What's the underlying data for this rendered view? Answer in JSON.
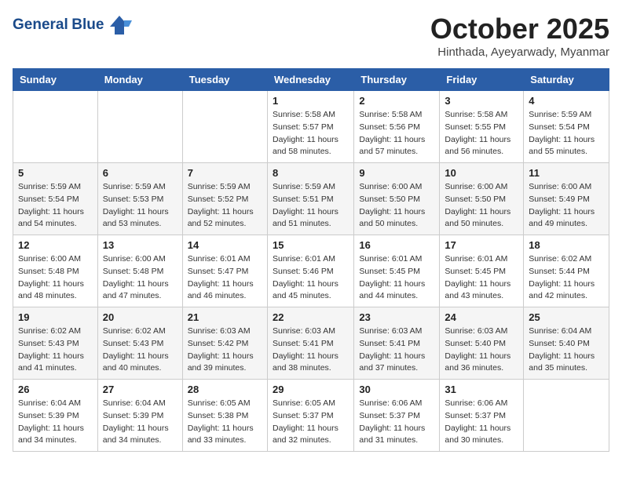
{
  "header": {
    "logo_line1": "General",
    "logo_line2": "Blue",
    "month_title": "October 2025",
    "subtitle": "Hinthada, Ayeyarwady, Myanmar"
  },
  "weekdays": [
    "Sunday",
    "Monday",
    "Tuesday",
    "Wednesday",
    "Thursday",
    "Friday",
    "Saturday"
  ],
  "weeks": [
    [
      {
        "day": "",
        "sunrise": "",
        "sunset": "",
        "daylight": ""
      },
      {
        "day": "",
        "sunrise": "",
        "sunset": "",
        "daylight": ""
      },
      {
        "day": "",
        "sunrise": "",
        "sunset": "",
        "daylight": ""
      },
      {
        "day": "1",
        "sunrise": "5:58 AM",
        "sunset": "5:57 PM",
        "daylight": "11 hours and 58 minutes."
      },
      {
        "day": "2",
        "sunrise": "5:58 AM",
        "sunset": "5:56 PM",
        "daylight": "11 hours and 57 minutes."
      },
      {
        "day": "3",
        "sunrise": "5:58 AM",
        "sunset": "5:55 PM",
        "daylight": "11 hours and 56 minutes."
      },
      {
        "day": "4",
        "sunrise": "5:59 AM",
        "sunset": "5:54 PM",
        "daylight": "11 hours and 55 minutes."
      }
    ],
    [
      {
        "day": "5",
        "sunrise": "5:59 AM",
        "sunset": "5:54 PM",
        "daylight": "11 hours and 54 minutes."
      },
      {
        "day": "6",
        "sunrise": "5:59 AM",
        "sunset": "5:53 PM",
        "daylight": "11 hours and 53 minutes."
      },
      {
        "day": "7",
        "sunrise": "5:59 AM",
        "sunset": "5:52 PM",
        "daylight": "11 hours and 52 minutes."
      },
      {
        "day": "8",
        "sunrise": "5:59 AM",
        "sunset": "5:51 PM",
        "daylight": "11 hours and 51 minutes."
      },
      {
        "day": "9",
        "sunrise": "6:00 AM",
        "sunset": "5:50 PM",
        "daylight": "11 hours and 50 minutes."
      },
      {
        "day": "10",
        "sunrise": "6:00 AM",
        "sunset": "5:50 PM",
        "daylight": "11 hours and 50 minutes."
      },
      {
        "day": "11",
        "sunrise": "6:00 AM",
        "sunset": "5:49 PM",
        "daylight": "11 hours and 49 minutes."
      }
    ],
    [
      {
        "day": "12",
        "sunrise": "6:00 AM",
        "sunset": "5:48 PM",
        "daylight": "11 hours and 48 minutes."
      },
      {
        "day": "13",
        "sunrise": "6:00 AM",
        "sunset": "5:48 PM",
        "daylight": "11 hours and 47 minutes."
      },
      {
        "day": "14",
        "sunrise": "6:01 AM",
        "sunset": "5:47 PM",
        "daylight": "11 hours and 46 minutes."
      },
      {
        "day": "15",
        "sunrise": "6:01 AM",
        "sunset": "5:46 PM",
        "daylight": "11 hours and 45 minutes."
      },
      {
        "day": "16",
        "sunrise": "6:01 AM",
        "sunset": "5:45 PM",
        "daylight": "11 hours and 44 minutes."
      },
      {
        "day": "17",
        "sunrise": "6:01 AM",
        "sunset": "5:45 PM",
        "daylight": "11 hours and 43 minutes."
      },
      {
        "day": "18",
        "sunrise": "6:02 AM",
        "sunset": "5:44 PM",
        "daylight": "11 hours and 42 minutes."
      }
    ],
    [
      {
        "day": "19",
        "sunrise": "6:02 AM",
        "sunset": "5:43 PM",
        "daylight": "11 hours and 41 minutes."
      },
      {
        "day": "20",
        "sunrise": "6:02 AM",
        "sunset": "5:43 PM",
        "daylight": "11 hours and 40 minutes."
      },
      {
        "day": "21",
        "sunrise": "6:03 AM",
        "sunset": "5:42 PM",
        "daylight": "11 hours and 39 minutes."
      },
      {
        "day": "22",
        "sunrise": "6:03 AM",
        "sunset": "5:41 PM",
        "daylight": "11 hours and 38 minutes."
      },
      {
        "day": "23",
        "sunrise": "6:03 AM",
        "sunset": "5:41 PM",
        "daylight": "11 hours and 37 minutes."
      },
      {
        "day": "24",
        "sunrise": "6:03 AM",
        "sunset": "5:40 PM",
        "daylight": "11 hours and 36 minutes."
      },
      {
        "day": "25",
        "sunrise": "6:04 AM",
        "sunset": "5:40 PM",
        "daylight": "11 hours and 35 minutes."
      }
    ],
    [
      {
        "day": "26",
        "sunrise": "6:04 AM",
        "sunset": "5:39 PM",
        "daylight": "11 hours and 34 minutes."
      },
      {
        "day": "27",
        "sunrise": "6:04 AM",
        "sunset": "5:39 PM",
        "daylight": "11 hours and 34 minutes."
      },
      {
        "day": "28",
        "sunrise": "6:05 AM",
        "sunset": "5:38 PM",
        "daylight": "11 hours and 33 minutes."
      },
      {
        "day": "29",
        "sunrise": "6:05 AM",
        "sunset": "5:37 PM",
        "daylight": "11 hours and 32 minutes."
      },
      {
        "day": "30",
        "sunrise": "6:06 AM",
        "sunset": "5:37 PM",
        "daylight": "11 hours and 31 minutes."
      },
      {
        "day": "31",
        "sunrise": "6:06 AM",
        "sunset": "5:37 PM",
        "daylight": "11 hours and 30 minutes."
      },
      {
        "day": "",
        "sunrise": "",
        "sunset": "",
        "daylight": ""
      }
    ]
  ],
  "labels": {
    "sunrise_prefix": "Sunrise: ",
    "sunset_prefix": "Sunset: ",
    "daylight_prefix": "Daylight: "
  }
}
